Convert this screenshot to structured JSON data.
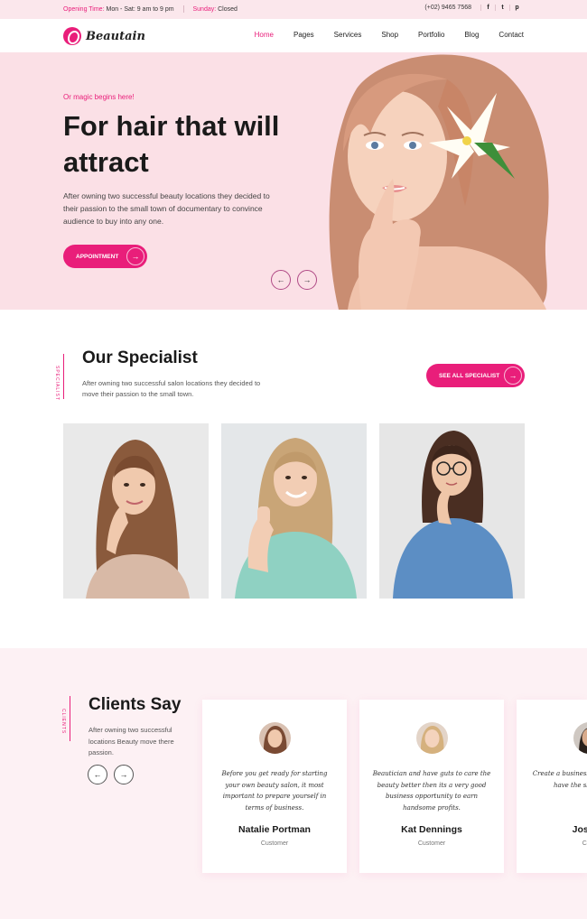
{
  "topbar": {
    "opening_label": "Opening Time:",
    "opening_value": "Mon - Sat: 9 am to 9 pm",
    "sunday_label": "Sunday:",
    "sunday_value": "Closed",
    "phone": "(+02) 9465 7568",
    "social": [
      "f",
      "t",
      "p"
    ]
  },
  "logo": {
    "text": "Beautain"
  },
  "nav": {
    "items": [
      "Home",
      "Pages",
      "Services",
      "Shop",
      "Portfolio",
      "Blog",
      "Contact"
    ],
    "active": "Home"
  },
  "hero": {
    "tagline": "Or magic begins here!",
    "title": "For hair that will attract",
    "description": "After owning two successful beauty locations they decided to their passion to the small town of documentary to convince audience to buy into any one.",
    "button_label": "APPOINTMENT",
    "prev_icon": "←",
    "next_icon": "→"
  },
  "specialist": {
    "side_label": "SPECIALIST",
    "title": "Our Specialist",
    "description": "After owning two successful salon locations they decided to move their passion to the small town.",
    "button_label": "SEE ALL SPECIALIST"
  },
  "clients": {
    "side_label": "CLIENTS",
    "title": "Clients Say",
    "description": "After owning two successful locations Beauty move there passion.",
    "prev_icon": "←",
    "next_icon": "→",
    "testimonials": [
      {
        "quote": "Before you get ready for starting your own beauty salon, it most important to prepare yourself in terms of business.",
        "name": "Natalie Portman",
        "role": "Customer"
      },
      {
        "quote": "Beautician and have guts to care the beauty better then its a very good business opportunity to earn handsome profits.",
        "name": "Kat Dennings",
        "role": "Customer"
      },
      {
        "quote": "Create a business to it for Better C have the skills, and th",
        "name": "Joshua",
        "role": "Cust"
      }
    ]
  },
  "colors": {
    "accent": "#e91e7a",
    "hero_bg": "#fbe0e6",
    "topbar_bg": "#fbe7ec"
  }
}
